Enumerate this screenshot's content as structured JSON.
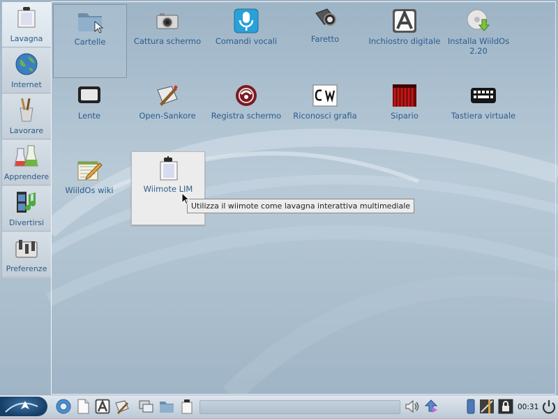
{
  "sidebar": {
    "categories": [
      {
        "label": "Lavagna",
        "icon": "whiteboard-icon",
        "active": true
      },
      {
        "label": "Internet",
        "icon": "globe-icon",
        "active": false
      },
      {
        "label": "Lavorare",
        "icon": "brushes-icon",
        "active": false
      },
      {
        "label": "Apprendere",
        "icon": "flasks-icon",
        "active": false
      },
      {
        "label": "Divertirsi",
        "icon": "film-music-icon",
        "active": false
      },
      {
        "label": "Preferenze",
        "icon": "settings-icon",
        "active": false
      }
    ]
  },
  "apps": [
    {
      "label": "Cartelle",
      "icon": "folder-icon"
    },
    {
      "label": "Cattura schermo",
      "icon": "camera-icon"
    },
    {
      "label": "Comandi vocali",
      "icon": "microphone-icon"
    },
    {
      "label": "Faretto",
      "icon": "spotlight-icon"
    },
    {
      "label": "Inchiostro digitale",
      "icon": "letter-a-icon"
    },
    {
      "label": "Installa WiildOs 2.20",
      "icon": "install-cd-icon"
    },
    {
      "label": "Lente",
      "icon": "magnifier-screen-icon"
    },
    {
      "label": "Open-Sankore",
      "icon": "pen-board-icon"
    },
    {
      "label": "Registra schermo",
      "icon": "record-screen-icon"
    },
    {
      "label": "Riconosci grafia",
      "icon": "handwriting-icon"
    },
    {
      "label": "Sipario",
      "icon": "curtain-icon"
    },
    {
      "label": "Tastiera virtuale",
      "icon": "keyboard-icon"
    },
    {
      "label": "WiildOs wiki",
      "icon": "notepad-pen-icon"
    },
    {
      "label": "Wiimote LIM",
      "icon": "wiimote-board-icon"
    }
  ],
  "tooltip": {
    "text": "Utilizza il wiimote come lavagna interattiva multimediale"
  },
  "taskbar": {
    "clock": "00:31"
  }
}
